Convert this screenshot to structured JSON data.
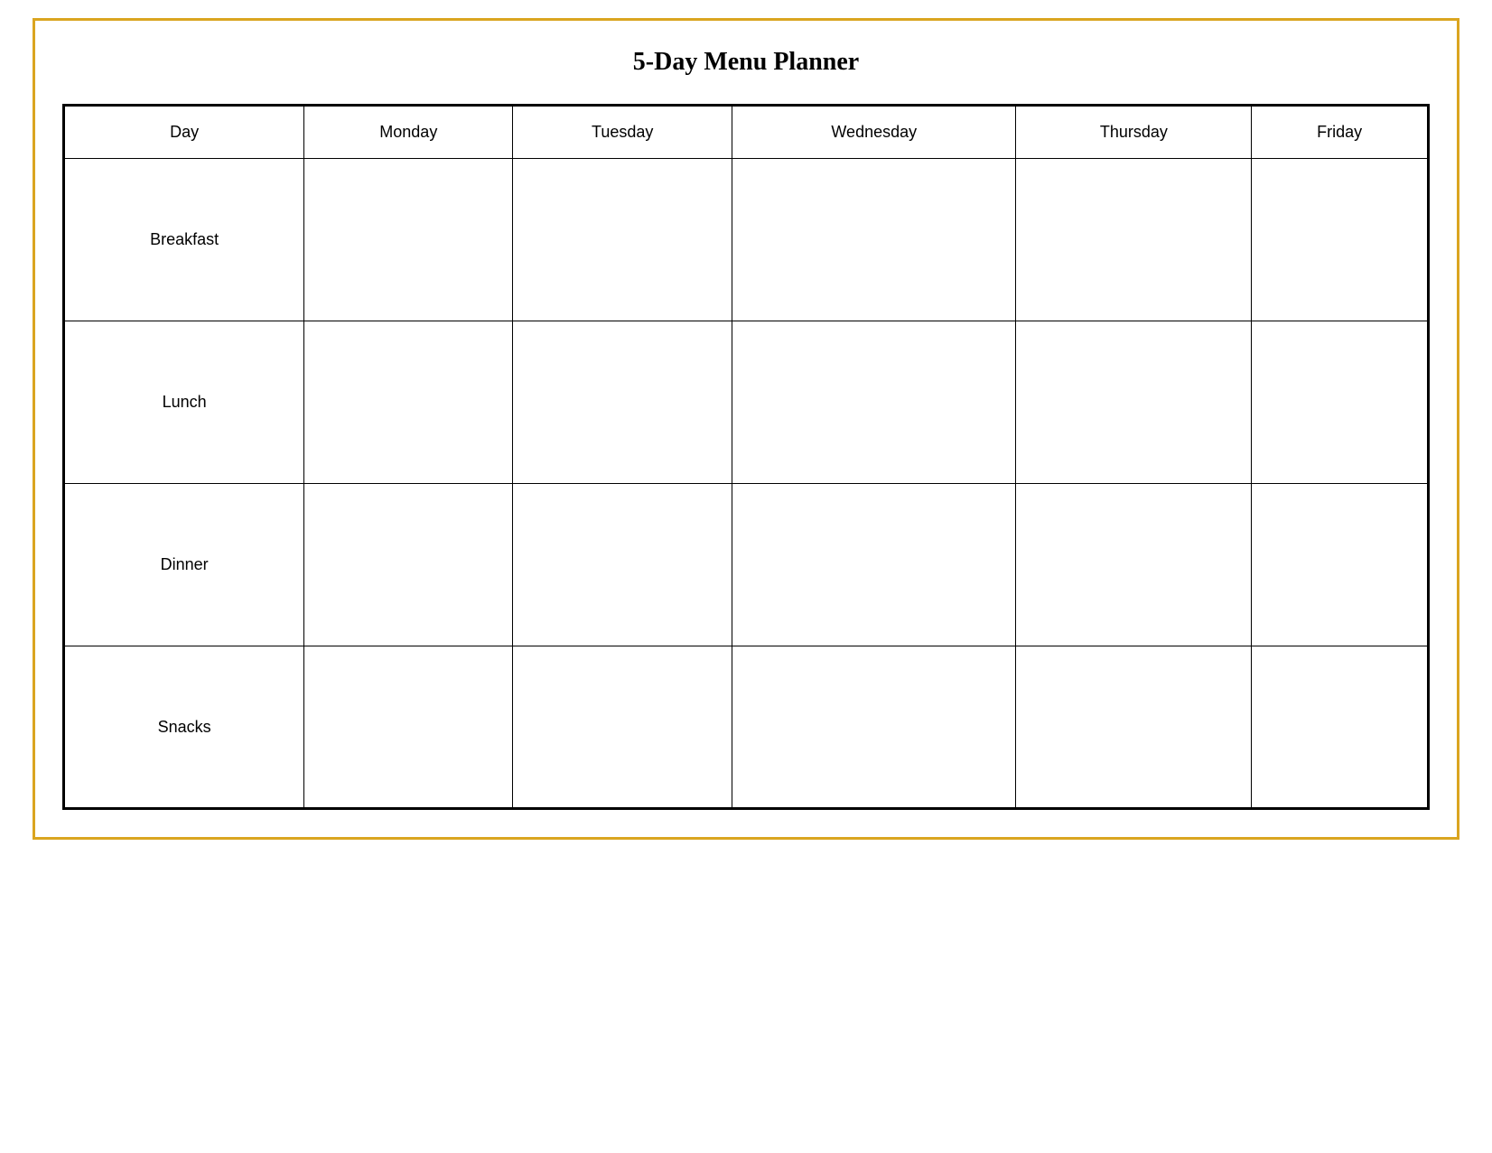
{
  "page": {
    "title": "5-Day Menu Planner",
    "border_color": "#DAA520"
  },
  "table": {
    "header": {
      "col0": "Day",
      "col1": "Monday",
      "col2": "Tuesday",
      "col3": "Wednesday",
      "col4": "Thursday",
      "col5": "Friday"
    },
    "rows": [
      {
        "label": "Breakfast"
      },
      {
        "label": "Lunch"
      },
      {
        "label": "Dinner"
      },
      {
        "label": "Snacks"
      }
    ]
  }
}
